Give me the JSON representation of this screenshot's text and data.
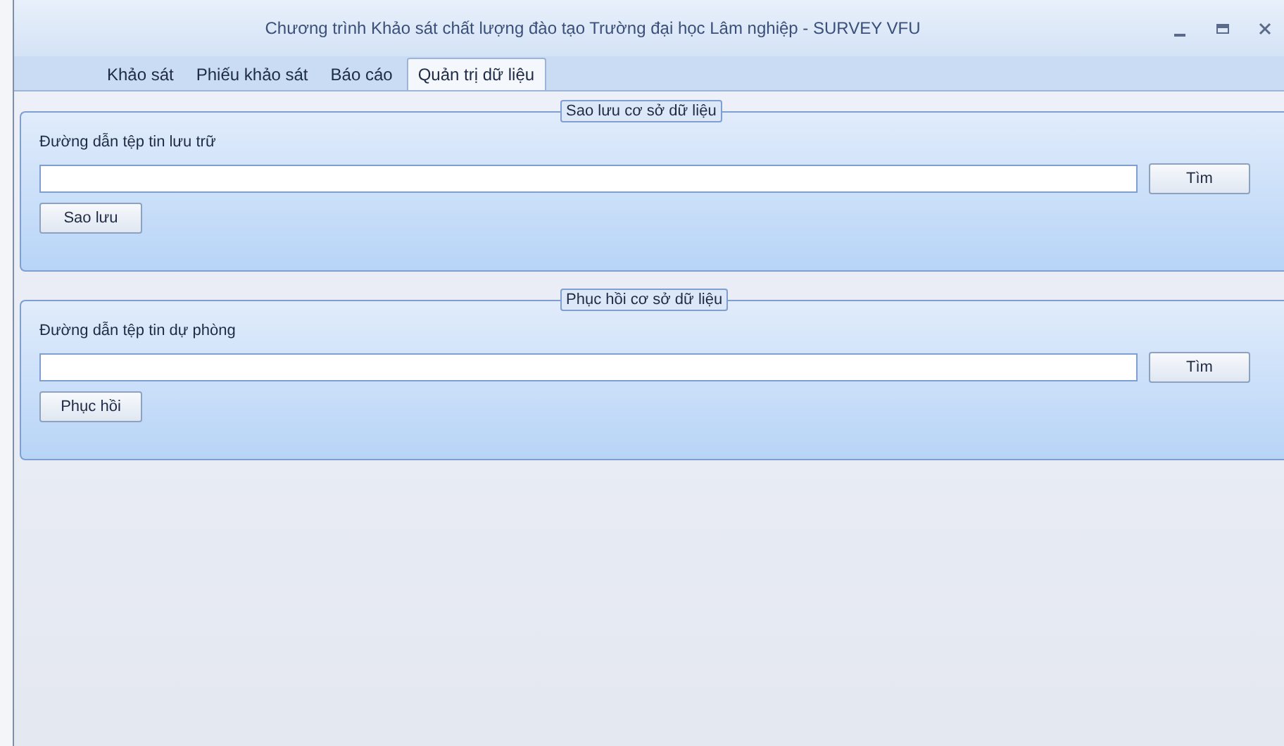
{
  "window": {
    "title": "Chương trình Khảo sát chất lượng đào tạo Trường đại học Lâm nghiệp - SURVEY VFU"
  },
  "tabs": [
    {
      "label": "Khảo sát",
      "selected": false
    },
    {
      "label": "Phiếu khảo sát",
      "selected": false
    },
    {
      "label": "Báo cáo",
      "selected": false
    },
    {
      "label": "Quản trị dữ liệu",
      "selected": true
    }
  ],
  "groups": [
    {
      "title": "Sao lưu cơ sở dữ liệu",
      "field_label": "Đường dẫn tệp tin lưu trữ",
      "browse_button": "Tìm",
      "action_button": "Sao lưu"
    },
    {
      "title": "Phục hồi cơ sở dữ liệu",
      "field_label": "Đường dẫn tệp tin dự phòng",
      "browse_button": "Tìm",
      "action_button": "Phục hồi"
    }
  ]
}
